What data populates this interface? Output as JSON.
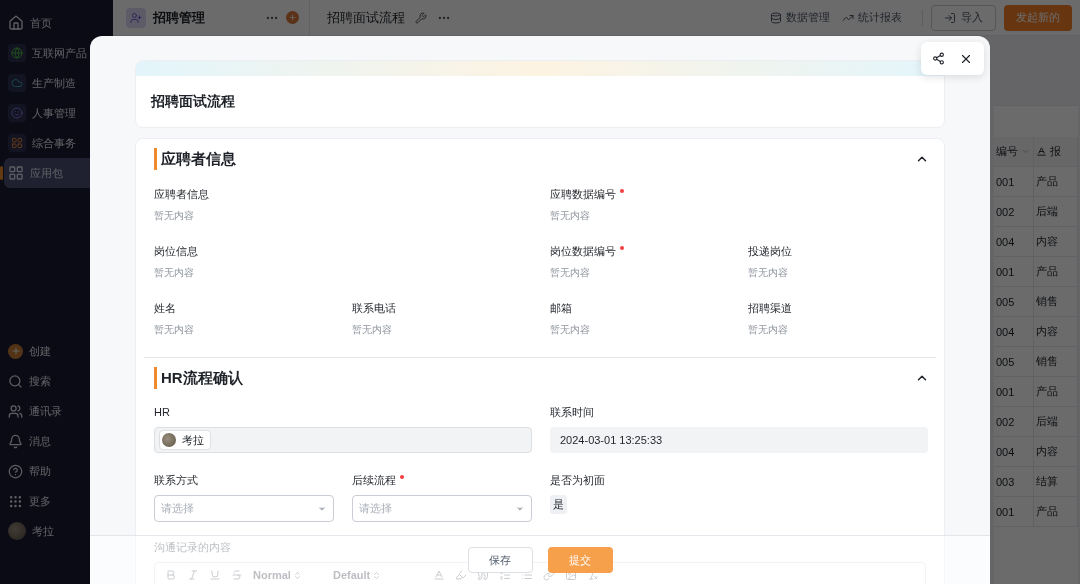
{
  "sidebar": {
    "items": [
      {
        "label": "首页",
        "selected": false
      },
      {
        "label": "互联网产品",
        "selected": false
      },
      {
        "label": "生产制造",
        "selected": false
      },
      {
        "label": "人事管理",
        "selected": false
      },
      {
        "label": "综合事务",
        "selected": false
      },
      {
        "label": "应用包",
        "selected": true
      }
    ],
    "bottom_items": [
      {
        "label": "创建"
      },
      {
        "label": "搜索"
      },
      {
        "label": "通讯录"
      },
      {
        "label": "消息"
      },
      {
        "label": "帮助"
      },
      {
        "label": "更多"
      }
    ],
    "user": {
      "name": "考拉"
    }
  },
  "topbar": {
    "app_title": "招聘管理",
    "page_title": "招聘面试流程",
    "actions": [
      {
        "label": "数据管理"
      },
      {
        "label": "统计报表"
      }
    ],
    "buttons": [
      {
        "label": "导入",
        "kind": "outline"
      },
      {
        "label": "发起新的",
        "kind": "primary"
      }
    ]
  },
  "background_table": {
    "columns": [
      "编号",
      "报"
    ],
    "rows": [
      [
        "001",
        "产品"
      ],
      [
        "002",
        "后端"
      ],
      [
        "004",
        "内容"
      ],
      [
        "001",
        "产品"
      ],
      [
        "005",
        "销售"
      ],
      [
        "004",
        "内容"
      ],
      [
        "005",
        "销售"
      ],
      [
        "001",
        "产品"
      ],
      [
        "002",
        "后端"
      ],
      [
        "004",
        "内容"
      ],
      [
        "003",
        "结算"
      ],
      [
        "001",
        "产品"
      ]
    ]
  },
  "dialog": {
    "title": "招聘面试流程",
    "sections": [
      {
        "title": "应聘者信息",
        "expanded": true,
        "rows": [
          [
            {
              "label": "应聘者信息",
              "required": false,
              "kind": "text",
              "value": "暂无内容"
            },
            "",
            {
              "label": "应聘数据编号",
              "required": true,
              "kind": "text",
              "value": "暂无内容"
            },
            ""
          ],
          [
            {
              "label": "岗位信息",
              "required": false,
              "kind": "text",
              "value": "暂无内容"
            },
            "",
            {
              "label": "岗位数据编号",
              "required": true,
              "kind": "text",
              "value": "暂无内容"
            },
            {
              "label": "投递岗位",
              "required": false,
              "kind": "text",
              "value": "暂无内容"
            }
          ],
          [
            {
              "label": "姓名",
              "required": false,
              "kind": "text",
              "value": "暂无内容"
            },
            {
              "label": "联系电话",
              "required": false,
              "kind": "text",
              "value": "暂无内容"
            },
            {
              "label": "邮箱",
              "required": false,
              "kind": "text",
              "value": "暂无内容"
            },
            {
              "label": "招聘渠道",
              "required": false,
              "kind": "text",
              "value": "暂无内容"
            }
          ]
        ]
      },
      {
        "title": "HR流程确认",
        "expanded": true,
        "rows": [
          [
            {
              "label": "HR",
              "required": false,
              "kind": "member",
              "value": "考拉"
            },
            "",
            {
              "label": "联系时间",
              "required": false,
              "kind": "datetime",
              "value": "2024-03-01 13:25:33"
            },
            ""
          ],
          [
            {
              "label": "联系方式",
              "required": false,
              "kind": "select",
              "placeholder": "请选择"
            },
            {
              "label": "后续流程",
              "required": true,
              "kind": "select",
              "placeholder": "请选择"
            },
            {
              "label": "是否为初面",
              "required": false,
              "kind": "tag",
              "value": "是"
            },
            ""
          ]
        ]
      }
    ],
    "notes": {
      "label": "沟通记录的内容",
      "toolbar_options": [
        "Normal",
        "Default"
      ]
    },
    "footer_buttons": [
      {
        "label": "保存",
        "kind": "default"
      },
      {
        "label": "提交",
        "kind": "primary"
      }
    ]
  }
}
